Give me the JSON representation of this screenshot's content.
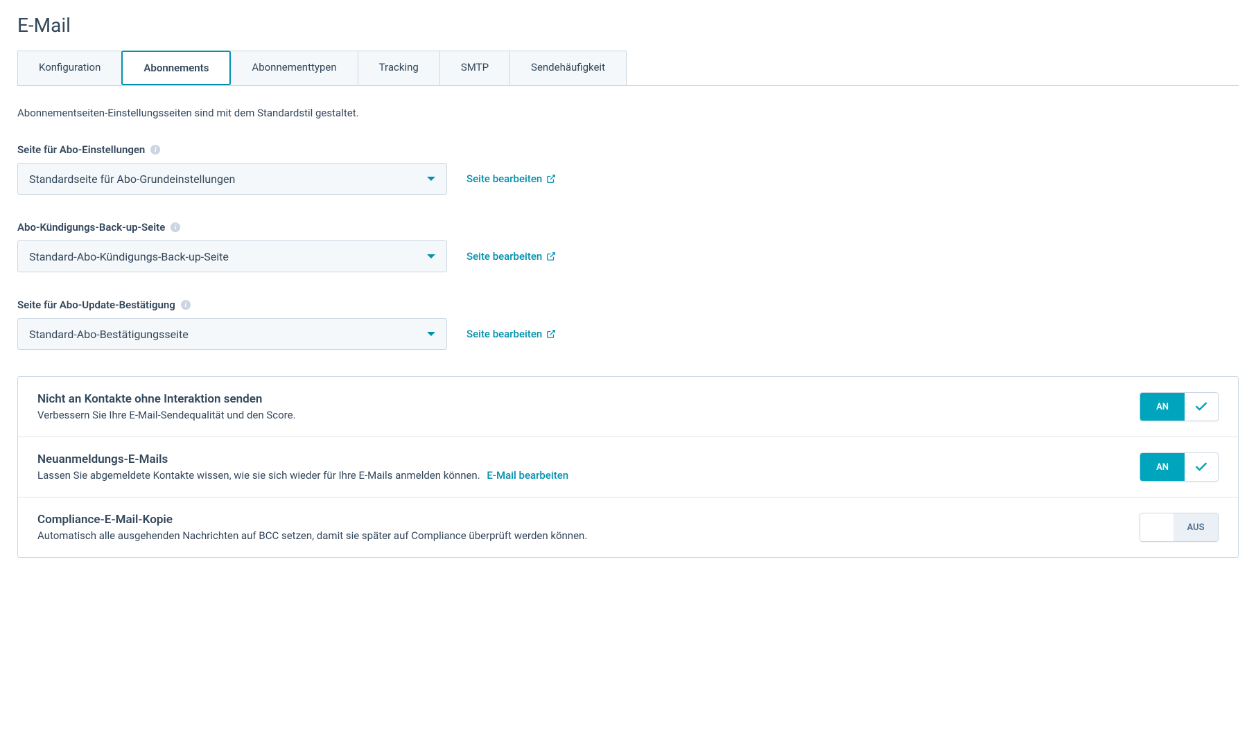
{
  "page": {
    "title": "E-Mail"
  },
  "tabs": [
    {
      "label": "Konfiguration"
    },
    {
      "label": "Abonnements"
    },
    {
      "label": "Abonnementtypen"
    },
    {
      "label": "Tracking"
    },
    {
      "label": "SMTP"
    },
    {
      "label": "Sendehäufigkeit"
    }
  ],
  "intro": "Abonnementseiten-Einstellungsseiten sind mit dem Standardstil gestaltet.",
  "fields": {
    "subscriptionPrefs": {
      "label": "Seite für Abo-Einstellungen",
      "value": "Standardseite für Abo-Grundeinstellungen",
      "editLink": "Seite bearbeiten"
    },
    "unsubscribeBackup": {
      "label": "Abo-Kündigungs-Back-up-Seite",
      "value": "Standard-Abo-Kündigungs-Back-up-Seite",
      "editLink": "Seite bearbeiten"
    },
    "updateConfirmation": {
      "label": "Seite für Abo-Update-Bestätigung",
      "value": "Standard-Abo-Bestätigungsseite",
      "editLink": "Seite bearbeiten"
    }
  },
  "toggles": {
    "unengaged": {
      "title": "Nicht an Kontakte ohne Interaktion senden",
      "desc": "Verbessern Sie Ihre E-Mail-Sendequalität und den Score.",
      "state": "AN"
    },
    "resubscribe": {
      "title": "Neuanmeldungs-E-Mails",
      "desc": "Lassen Sie abgemeldete Kontakte wissen, wie sie sich wieder für Ihre E-Mails anmelden können.",
      "link": "E-Mail bearbeiten",
      "state": "AN"
    },
    "compliance": {
      "title": "Compliance-E-Mail-Kopie",
      "desc": "Automatisch alle ausgehenden Nachrichten auf BCC setzen, damit sie später auf Compliance überprüft werden können.",
      "state": "AUS"
    }
  },
  "icons": {
    "info": "i"
  }
}
